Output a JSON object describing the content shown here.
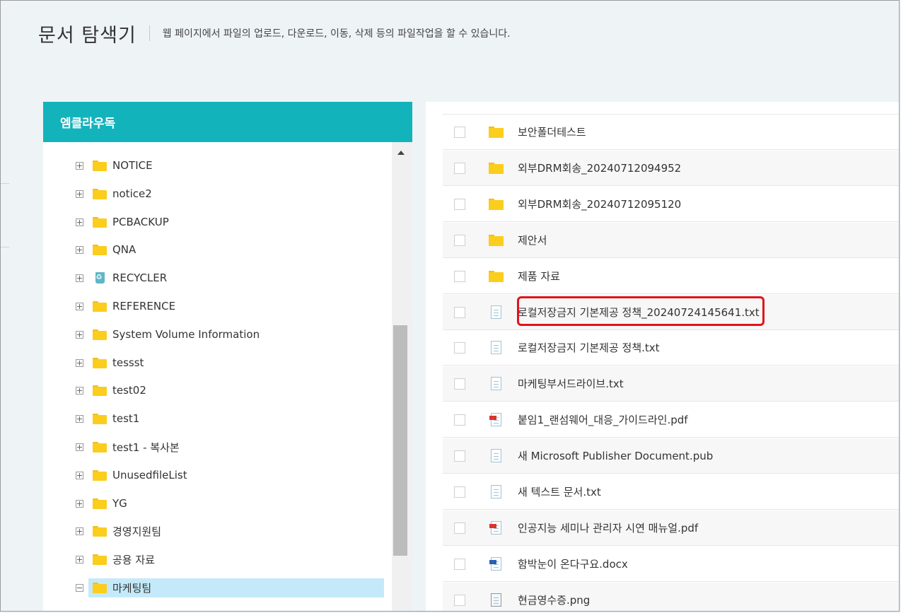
{
  "header": {
    "title": "문서 탐색기",
    "description": "웹 페이지에서 파일의 업로드, 다운로드, 이동, 삭제 등의 파일작업을 할 수 있습니다."
  },
  "tree": {
    "root_label": "엠클라우독",
    "items": [
      {
        "label": "NOTICE",
        "icon": "folder-icon",
        "expander": "plus"
      },
      {
        "label": "notice2",
        "icon": "folder-icon",
        "expander": "plus"
      },
      {
        "label": "PCBACKUP",
        "icon": "folder-icon",
        "expander": "plus"
      },
      {
        "label": "QNA",
        "icon": "folder-icon",
        "expander": "plus"
      },
      {
        "label": "RECYCLER",
        "icon": "recycle-bin-icon",
        "expander": "plus"
      },
      {
        "label": "REFERENCE",
        "icon": "folder-icon",
        "expander": "plus"
      },
      {
        "label": "System Volume Information",
        "icon": "folder-icon",
        "expander": "plus"
      },
      {
        "label": "tessst",
        "icon": "folder-icon",
        "expander": "plus"
      },
      {
        "label": "test02",
        "icon": "folder-icon",
        "expander": "plus"
      },
      {
        "label": "test1",
        "icon": "folder-icon",
        "expander": "plus"
      },
      {
        "label": "test1 - 복사본",
        "icon": "folder-icon",
        "expander": "plus"
      },
      {
        "label": "UnusedfileList",
        "icon": "folder-icon",
        "expander": "plus"
      },
      {
        "label": "YG",
        "icon": "folder-icon",
        "expander": "plus"
      },
      {
        "label": "경영지원팀",
        "icon": "folder-icon",
        "expander": "plus"
      },
      {
        "label": "공용 자료",
        "icon": "folder-icon",
        "expander": "plus"
      },
      {
        "label": "마케팅팀",
        "icon": "folder-icon",
        "expander": "minus",
        "selected": true
      }
    ]
  },
  "files": [
    {
      "name": "보안폴더테스트",
      "type": "folder"
    },
    {
      "name": "외부DRM회송_20240712094952",
      "type": "folder"
    },
    {
      "name": "외부DRM회송_20240712095120",
      "type": "folder"
    },
    {
      "name": "제안서",
      "type": "folder"
    },
    {
      "name": "제품 자료",
      "type": "folder"
    },
    {
      "name": "로컬저장금지 기본제공 정책_20240724145641.txt",
      "type": "text",
      "highlighted": true
    },
    {
      "name": "로컬저장금지 기본제공 정책.txt",
      "type": "text"
    },
    {
      "name": "마케팅부서드라이브.txt",
      "type": "text"
    },
    {
      "name": "붙임1_랜섬웨어_대응_가이드라인.pdf",
      "type": "pdf"
    },
    {
      "name": "새 Microsoft Publisher Document.pub",
      "type": "text"
    },
    {
      "name": "새 텍스트 문서.txt",
      "type": "text"
    },
    {
      "name": "인공지능 세미나 관리자 시연 매뉴얼.pdf",
      "type": "pdf"
    },
    {
      "name": "함박눈이 온다구요.docx",
      "type": "word"
    },
    {
      "name": "현금영수증.png",
      "type": "image"
    }
  ],
  "colors": {
    "accent": "#13b3bc",
    "selected": "#c4eafa",
    "highlight": "#e0141b",
    "folder": "#fbcd1d"
  }
}
